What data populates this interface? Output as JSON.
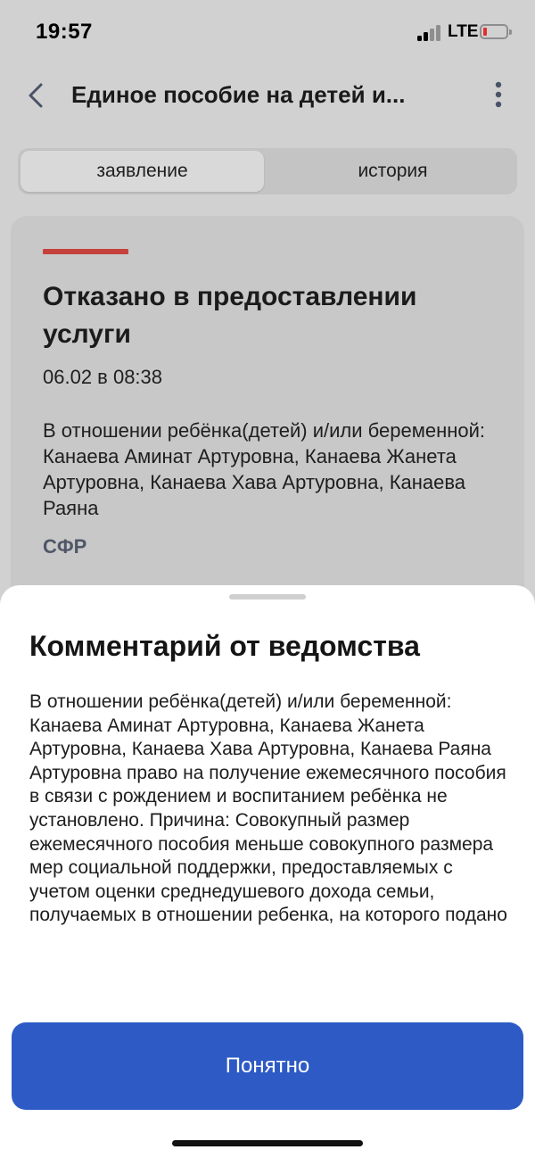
{
  "status_bar": {
    "time": "19:57",
    "network": "LTE",
    "icons": [
      "signal-icon",
      "battery-icon"
    ],
    "battery_color": "#e0302d"
  },
  "nav": {
    "title": "Единое пособие на детей и...",
    "back_icon": "chevron-left-icon",
    "menu_icon": "more-vertical-icon"
  },
  "tabs": [
    {
      "label": "заявление",
      "active": true
    },
    {
      "label": "история",
      "active": false
    }
  ],
  "card": {
    "status_title": "Отказано в предоставлении услуги",
    "status_color": "#c5423c",
    "date": "06.02 в 08:38",
    "description": "В отношении ребёнка(детей) и/или беременной: Канаева Аминат Артуровна, Канаева Жанета Артуровна, Канаева Хава Артуровна, Канаева Раяна",
    "agency": "СФР"
  },
  "sheet": {
    "title": "Комментарий от ведомства",
    "body": "В отношении ребёнка(детей) и/или беременной: Канаева Аминат Артуровна, Канаева Жанета Артуровна, Канаева Хава Артуровна, Канаева Раяна Артуровна право на получение ежемесячного пособия в связи с рождением и воспитанием ребёнка не установлено. Причина: Совокупный размер ежемесячного пособия меньше совокупного размера мер социальной поддержки, предоставляемых с учетом оценки среднедушевого дохода семьи, получаемых в отношении ребенка, на которого подано",
    "button_label": "Понятно",
    "button_color": "#2d5ac5"
  }
}
